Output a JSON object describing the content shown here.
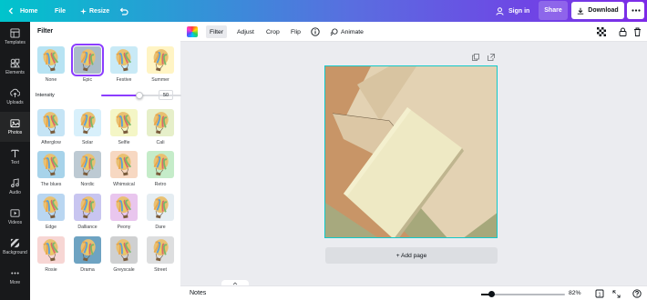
{
  "topbar": {
    "home_label": "Home",
    "file_label": "File",
    "resize_label": "Resize",
    "signin_label": "Sign in",
    "share_label": "Share",
    "download_label": "Download"
  },
  "leftnav": {
    "items": [
      {
        "label": "Templates",
        "icon": "templates-icon"
      },
      {
        "label": "Elements",
        "icon": "elements-icon"
      },
      {
        "label": "Uploads",
        "icon": "upload-icon"
      },
      {
        "label": "Photos",
        "icon": "photos-icon"
      },
      {
        "label": "Text",
        "icon": "text-icon"
      },
      {
        "label": "Audio",
        "icon": "audio-icon"
      },
      {
        "label": "Videos",
        "icon": "video-icon"
      },
      {
        "label": "Background",
        "icon": "background-icon"
      },
      {
        "label": "More",
        "icon": "more-icon"
      }
    ],
    "active": "Photos"
  },
  "filter_panel": {
    "title": "Filter",
    "intensity_label": "Intensity",
    "intensity_value": "50",
    "intensity_fraction": 0.5,
    "selected": "Epic",
    "filters": [
      {
        "label": "None",
        "tint": "#b7e3f3"
      },
      {
        "label": "Epic",
        "tint": "#aabcc9"
      },
      {
        "label": "Festive",
        "tint": "#c9eaf6"
      },
      {
        "label": "Summer",
        "tint": "#fff4c4"
      },
      {
        "label": "Afterglow",
        "tint": "#c5e4f5"
      },
      {
        "label": "Solar",
        "tint": "#d8f0fb"
      },
      {
        "label": "Selfie",
        "tint": "#f4f6c6"
      },
      {
        "label": "Cali",
        "tint": "#e6efc9"
      },
      {
        "label": "The blues",
        "tint": "#a7d3ea"
      },
      {
        "label": "Nordic",
        "tint": "#bdcad3"
      },
      {
        "label": "Whimsical",
        "tint": "#f7d8c2"
      },
      {
        "label": "Retro",
        "tint": "#c5ecc9"
      },
      {
        "label": "Edge",
        "tint": "#b9d6f1"
      },
      {
        "label": "Dalliance",
        "tint": "#c8c5f0"
      },
      {
        "label": "Peony",
        "tint": "#e9c6ee"
      },
      {
        "label": "Dare",
        "tint": "#e5edf2"
      },
      {
        "label": "Rosie",
        "tint": "#f7d6d4"
      },
      {
        "label": "Drama",
        "tint": "#6ea3c2"
      },
      {
        "label": "Greyscale",
        "tint": "#cfd0d1"
      },
      {
        "label": "Street",
        "tint": "#dddedf"
      }
    ]
  },
  "toolbar": {
    "filter_label": "Filter",
    "adjust_label": "Adjust",
    "crop_label": "Crop",
    "flip_label": "Flip",
    "animate_label": "Animate"
  },
  "canvas": {
    "add_page_label": "+ Add page"
  },
  "bottombar": {
    "notes_label": "Notes",
    "zoom_label": "82%",
    "zoom_fraction": 0.13,
    "page_count": "1"
  }
}
